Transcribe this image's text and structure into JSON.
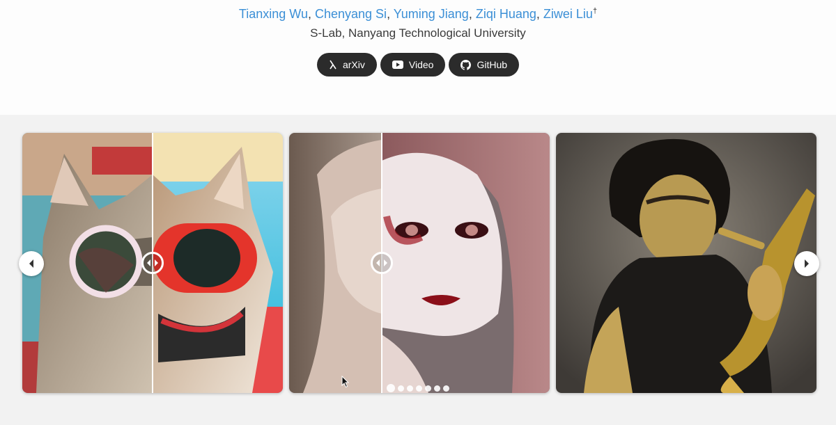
{
  "authors": [
    {
      "name": "Tianxing Wu",
      "sep": ", "
    },
    {
      "name": "Chenyang Si",
      "sep": ", "
    },
    {
      "name": "Yuming Jiang",
      "sep": ", "
    },
    {
      "name": "Ziqi Huang",
      "sep": ", "
    },
    {
      "name": "Ziwei Liu",
      "sep": ""
    }
  ],
  "author_mark": "†",
  "affiliation": "S-Lab, Nanyang Technological University",
  "buttons": {
    "arxiv": {
      "label": "arXiv",
      "icon": "arxiv-icon"
    },
    "video": {
      "label": "Video",
      "icon": "youtube-icon"
    },
    "github": {
      "label": "GitHub",
      "icon": "github-icon"
    }
  },
  "carousel": {
    "slides": [
      {
        "subject": "cat with red sunglasses"
      },
      {
        "subject": "gothic woman portrait"
      },
      {
        "subject": "boy playing saxophone"
      }
    ],
    "dot_count": 7,
    "active_dot": 0
  },
  "colors": {
    "link": "#3b8fd6",
    "button_bg": "#2b2b2b",
    "band_bg": "#f2f2f2"
  }
}
